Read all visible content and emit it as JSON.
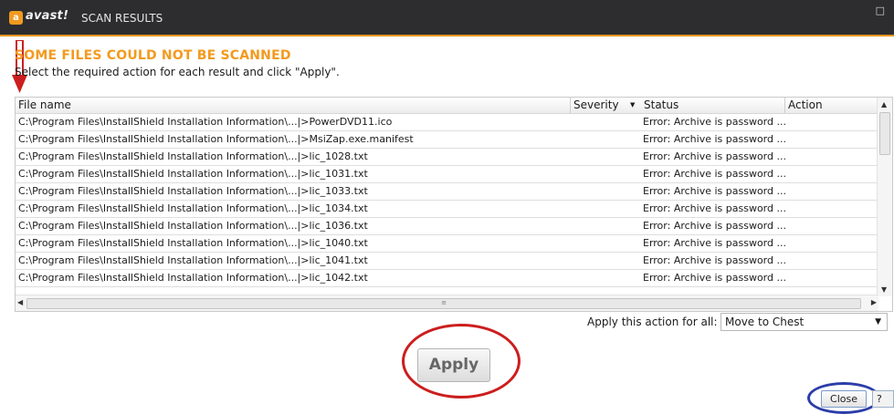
{
  "window": {
    "brand": "avast!",
    "title": "SCAN RESULTS",
    "restore_glyph": "□",
    "colors": {
      "titlebar": "#2d2d2f",
      "accent": "#f39a1e"
    }
  },
  "heading": "SOME FILES COULD NOT BE SCANNED",
  "subheading": "Select the required action for each result and click \"Apply\".",
  "table": {
    "columns": [
      "File name",
      "Severity",
      "Status",
      "Action"
    ],
    "rows": [
      {
        "file": "C:\\Program Files\\InstallShield Installation Information\\...|>PowerDVD11.ico",
        "severity": "",
        "status": "Error: Archive is password ...",
        "action": ""
      },
      {
        "file": "C:\\Program Files\\InstallShield Installation Information\\...|>MsiZap.exe.manifest",
        "severity": "",
        "status": "Error: Archive is password ...",
        "action": ""
      },
      {
        "file": "C:\\Program Files\\InstallShield Installation Information\\...|>lic_1028.txt",
        "severity": "",
        "status": "Error: Archive is password ...",
        "action": ""
      },
      {
        "file": "C:\\Program Files\\InstallShield Installation Information\\...|>lic_1031.txt",
        "severity": "",
        "status": "Error: Archive is password ...",
        "action": ""
      },
      {
        "file": "C:\\Program Files\\InstallShield Installation Information\\...|>lic_1033.txt",
        "severity": "",
        "status": "Error: Archive is password ...",
        "action": ""
      },
      {
        "file": "C:\\Program Files\\InstallShield Installation Information\\...|>lic_1034.txt",
        "severity": "",
        "status": "Error: Archive is password ...",
        "action": ""
      },
      {
        "file": "C:\\Program Files\\InstallShield Installation Information\\...|>lic_1036.txt",
        "severity": "",
        "status": "Error: Archive is password ...",
        "action": ""
      },
      {
        "file": "C:\\Program Files\\InstallShield Installation Information\\...|>lic_1040.txt",
        "severity": "",
        "status": "Error: Archive is password ...",
        "action": ""
      },
      {
        "file": "C:\\Program Files\\InstallShield Installation Information\\...|>lic_1041.txt",
        "severity": "",
        "status": "Error: Archive is password ...",
        "action": ""
      },
      {
        "file": "C:\\Program Files\\InstallShield Installation Information\\...|>lic_1042.txt",
        "severity": "",
        "status": "Error: Archive is password ...",
        "action": ""
      }
    ]
  },
  "apply_all": {
    "label": "Apply this action for all:",
    "selected": "Move to Chest"
  },
  "buttons": {
    "apply": "Apply",
    "close": "Close",
    "help": "?"
  },
  "annotations": {
    "red": "#cc1e1e",
    "blue": "#2b3ea8"
  }
}
